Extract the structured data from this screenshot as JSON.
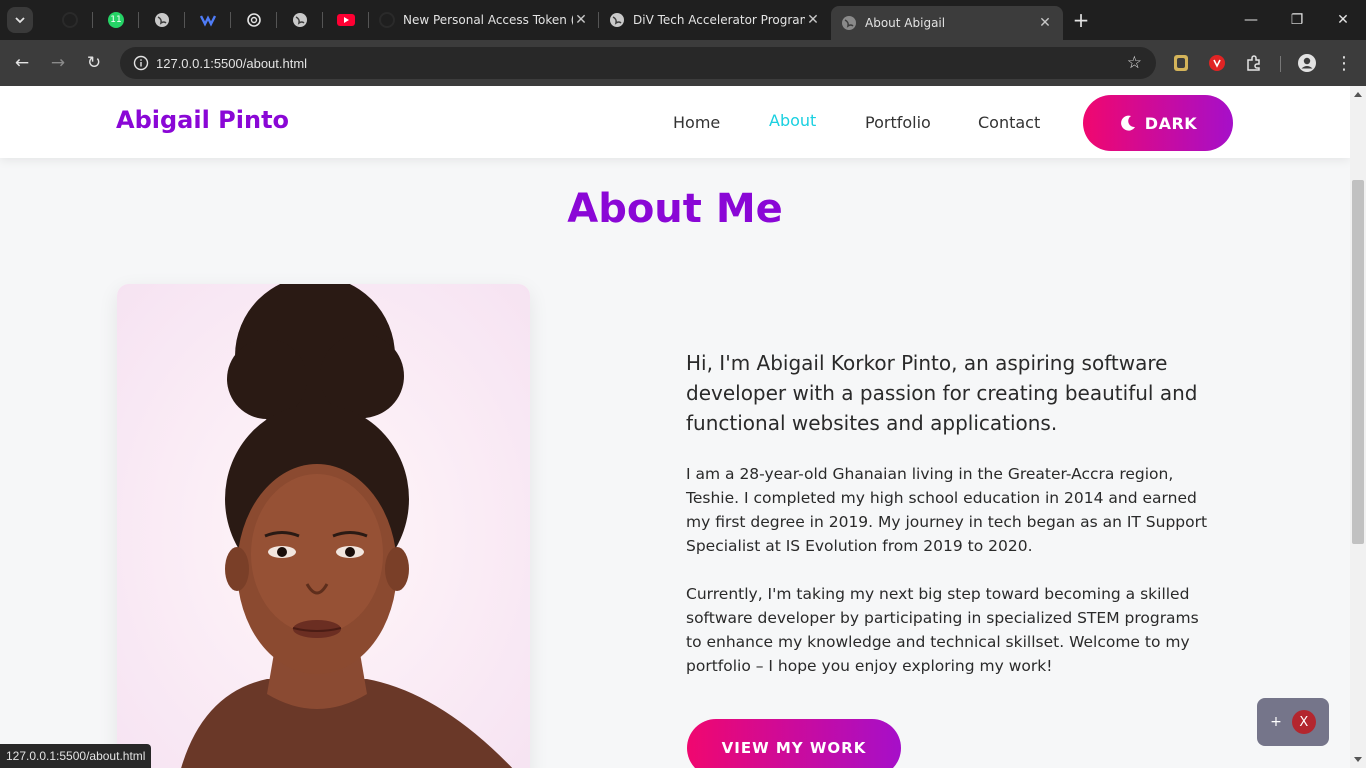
{
  "browser": {
    "tabs": [
      {
        "title": "New Personal Access Token (Cla",
        "icon": "github-icon"
      },
      {
        "title": "DiV Tech Accelerator Program F",
        "icon": "globe-icon"
      },
      {
        "title": "About Abigail",
        "icon": "globe-icon",
        "active": true
      }
    ],
    "pinned_badge": "11",
    "url": "127.0.0.1:5500/about.html",
    "status_url": "127.0.0.1:5500/about.html"
  },
  "site": {
    "logo": "Abigail Pinto",
    "nav": [
      "Home",
      "About",
      "Portfolio",
      "Contact"
    ],
    "theme_button": "DARK",
    "accent": "#8a07d6",
    "active_link_color": "#1ad0e0"
  },
  "about": {
    "heading": "About Me",
    "lead": "Hi, I'm Abigail Korkor Pinto, an aspiring software developer with a passion for creating beautiful and functional websites and applications.",
    "p1": "I am a 28-year-old Ghanaian living in the Greater-Accra region, Teshie. I completed my high school education in 2014 and earned my first degree in 2019. My journey in tech began as an IT Support Specialist at IS Evolution from 2019 to 2020.",
    "p2": "Currently, I'm taking my next big step toward becoming a skilled software developer by participating in specialized STEM programs to enhance my knowledge and technical skillset. Welcome to my portfolio – I hope you enjoy exploring my work!",
    "cta": "VIEW MY WORK"
  },
  "widget": {
    "plus": "+",
    "close": "X"
  }
}
